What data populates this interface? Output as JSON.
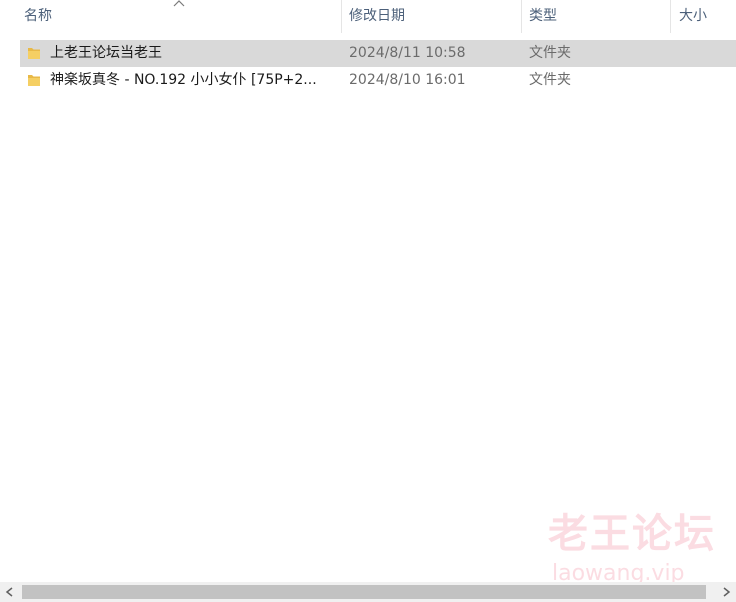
{
  "columns": {
    "name": "名称",
    "date": "修改日期",
    "type": "类型",
    "size": "大小"
  },
  "rows": [
    {
      "name": "上老王论坛当老王",
      "date": "2024/8/11 10:58",
      "type": "文件夹",
      "selected": true
    },
    {
      "name": "神楽坂真冬 - NO.192 小小女仆 [75P+2...",
      "date": "2024/8/10 16:01",
      "type": "文件夹",
      "selected": false
    }
  ],
  "watermark": {
    "cn": "老王论坛",
    "en": "laowang.vip"
  },
  "icons": {
    "sort": "sort-ascending-caret",
    "folder": "folder-icon",
    "scroll_left": "chevron-left-icon",
    "scroll_right": "chevron-right-icon"
  },
  "colors": {
    "header_text": "#4c607a",
    "selected_row": "#d9d9d9",
    "folder": "#e8b948",
    "watermark": "#f08096"
  }
}
